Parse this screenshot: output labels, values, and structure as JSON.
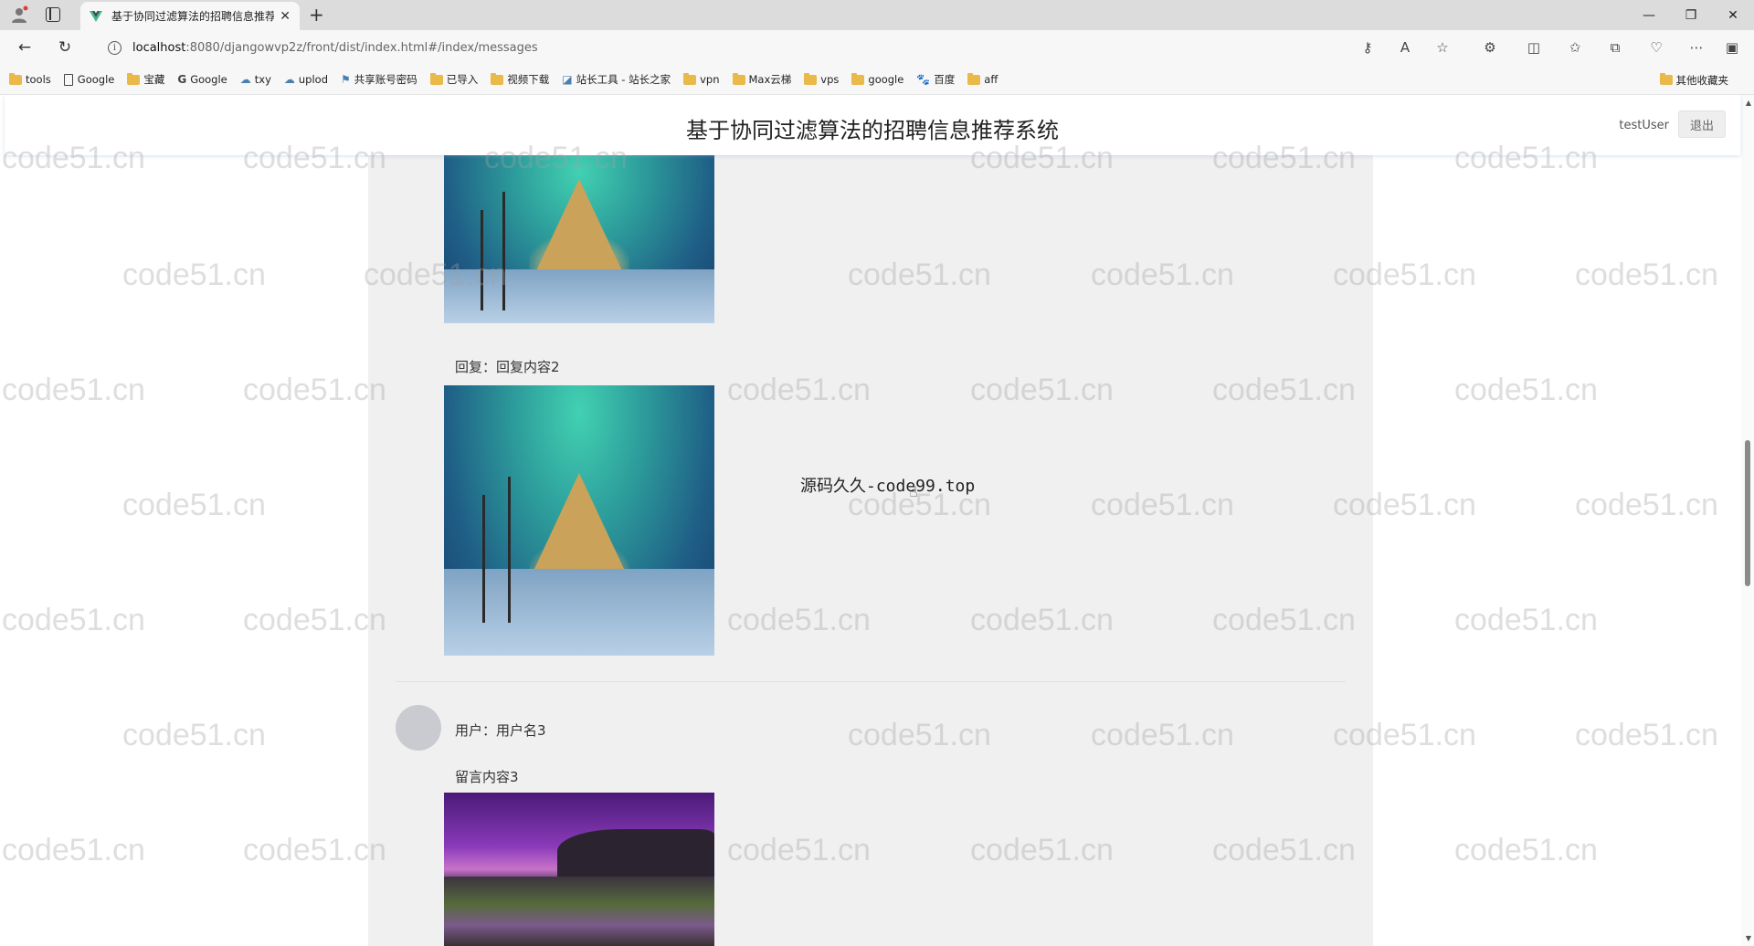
{
  "browser": {
    "tab_title": "基于协同过滤算法的招聘信息推荐",
    "url_host": "localhost",
    "url_path": ":8080/djangowvp2z/front/dist/index.html#/index/messages",
    "bookmarks": [
      "tools",
      "Google",
      "宝藏",
      "Google",
      "txy",
      "uplod",
      "共享账号密码",
      "已导入",
      "视频下载",
      "站长工具 - 站长之家",
      "vpn",
      "Max云梯",
      "vps",
      "google",
      "百度",
      "aff"
    ],
    "bookmark_other": "其他收藏夹"
  },
  "header": {
    "title": "基于协同过滤算法的招聘信息推荐系统",
    "username": "testUser",
    "logout_label": "退出"
  },
  "messages": {
    "reply_2": "回复：回复内容2",
    "user_3": "用户：用户名3",
    "content_3": "留言内容3"
  },
  "overlay": {
    "text": "源码久久-code99.top"
  },
  "watermark": {
    "text": "code51.cn"
  },
  "colors": {
    "content_bg": "#f0f0f0",
    "folder": "#e9b949"
  }
}
